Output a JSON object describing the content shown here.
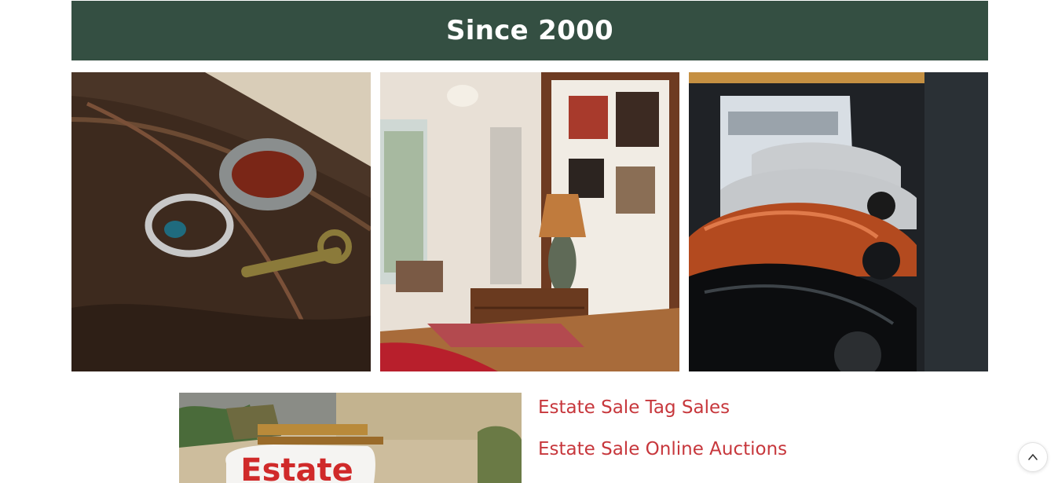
{
  "banner": {
    "title": "Since 2000",
    "background": "#344f42"
  },
  "gallery": [
    {
      "name": "rings-and-key"
    },
    {
      "name": "vintage-living-room"
    },
    {
      "name": "sports-cars-garage"
    }
  ],
  "estate_photo": {
    "sign_text": "Estate"
  },
  "links": [
    {
      "label": "Estate Sale Tag Sales"
    },
    {
      "label": "Estate Sale Online Auctions"
    }
  ],
  "colors": {
    "link": "#c7373c",
    "banner": "#344f42"
  },
  "scroll_top": {
    "icon": "chevron-up-icon"
  }
}
